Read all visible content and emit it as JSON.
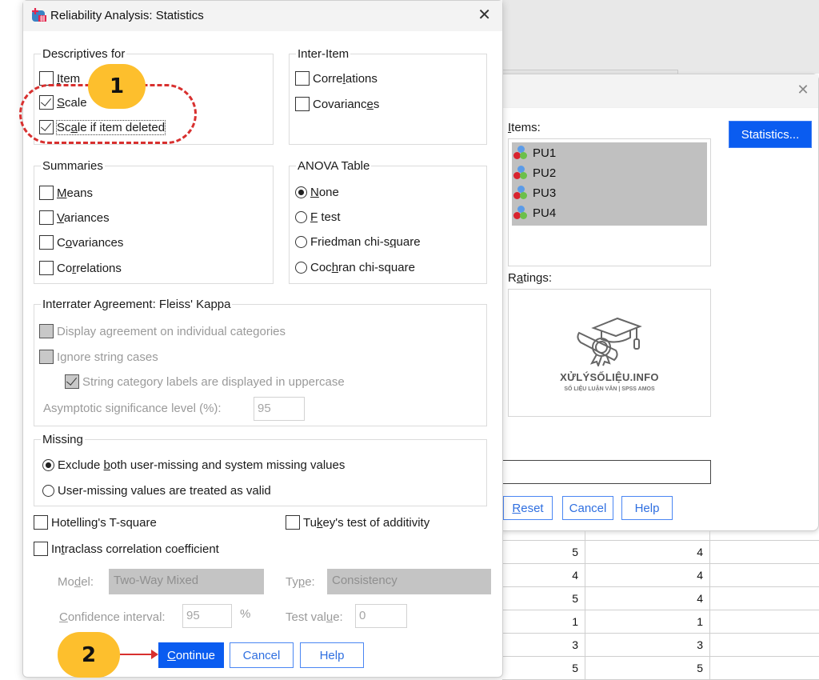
{
  "dialog": {
    "title": "Reliability Analysis: Statistics",
    "close_glyph": "✕",
    "descriptives": {
      "legend": "Descriptives for",
      "item": {
        "label": "Item",
        "checked": false
      },
      "scale": {
        "label": "Scale",
        "checked": true
      },
      "scale_if_deleted": {
        "label": "Scale if item deleted",
        "checked": true
      }
    },
    "inter_item": {
      "legend": "Inter-Item",
      "correlations": {
        "label": "Correlations",
        "checked": false
      },
      "covariances": {
        "label": "Covariances",
        "checked": false
      }
    },
    "summaries": {
      "legend": "Summaries",
      "means": {
        "label": "Means",
        "checked": false
      },
      "variances": {
        "label": "Variances",
        "checked": false
      },
      "covariances": {
        "label": "Covariances",
        "checked": false
      },
      "correlations": {
        "label": "Correlations",
        "checked": false
      }
    },
    "anova": {
      "legend": "ANOVA Table",
      "selected": "None",
      "options": [
        "None",
        "F test",
        "Friedman chi-square",
        "Cochran chi-square"
      ]
    },
    "interrater": {
      "legend": "Interrater Agreement: Fleiss' Kappa",
      "display_agreement": {
        "label": "Display agreement on individual categories",
        "checked": false
      },
      "ignore_string_cases": {
        "label": "Ignore string cases",
        "checked": false
      },
      "uppercase_labels": {
        "label": "String category labels are displayed in uppercase",
        "checked": true
      },
      "asymptotic_label": "Asymptotic significance level (%):",
      "asymptotic_value": "95"
    },
    "missing": {
      "legend": "Missing",
      "selected": "Exclude both user-missing and system missing values",
      "options": [
        "Exclude both user-missing and system missing values",
        "User-missing values are treated as valid"
      ]
    },
    "hotelling": {
      "label": "Hotelling's T-square",
      "checked": false
    },
    "tukey": {
      "label": "Tukey's test of additivity",
      "checked": false
    },
    "intraclass": {
      "label": "Intraclass correlation coefficient",
      "checked": false
    },
    "model_label": "Model:",
    "model_value": "Two-Way Mixed",
    "type_label": "Type:",
    "type_value": "Consistency",
    "ci_label": "Confidence interval:",
    "ci_value": "95",
    "ci_unit": "%",
    "test_value_label": "Test value:",
    "test_value": "0",
    "buttons": {
      "continue": "Continue",
      "cancel": "Cancel",
      "help": "Help"
    }
  },
  "back_dialog": {
    "close_glyph": "✕",
    "items_label": "Items:",
    "items": [
      "PU1",
      "PU2",
      "PU3",
      "PU4"
    ],
    "statistics_button": "Statistics...",
    "ratings_label": "Ratings:",
    "watermark_title": "XỬLÝSỐLIỆU.INFO",
    "watermark_sub": "SỐ LIỆU LUẬN VĂN | SPSS AMOS",
    "scale_label_value": "",
    "buttons": {
      "reset": "Reset",
      "cancel": "Cancel",
      "help": "Help"
    }
  },
  "data_grid": {
    "rows": [
      [
        "5",
        "4"
      ],
      [
        "4",
        "4"
      ],
      [
        "5",
        "4"
      ],
      [
        "1",
        "1"
      ],
      [
        "3",
        "3"
      ],
      [
        "5",
        "5"
      ]
    ]
  },
  "annotations": {
    "step1": "1",
    "step2": "2",
    "accent_color": "#fdbf2d",
    "highlight_color": "#d8302f"
  }
}
